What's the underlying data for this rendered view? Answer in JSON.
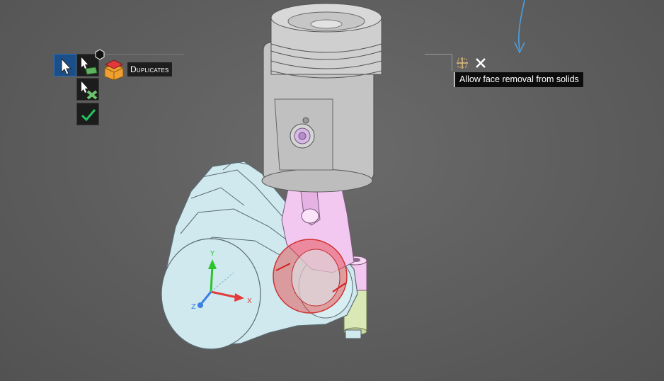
{
  "scene": {
    "triad": {
      "x_label": "X",
      "y_label": "Y",
      "z_label": "Z"
    }
  },
  "toolbar": {
    "select_tool": "select-arrow-icon",
    "duplicates_label": "Duplicates",
    "tooltip_text": "Allow face removal from solids"
  },
  "colors": {
    "background": "#5d5d5d",
    "housing": "#cfe9ef",
    "piston": "#c4c4c4",
    "rod": "#f2c8f0",
    "highlight_ring": "#e33b3b",
    "active_tool": "#1a4f8a",
    "check": "#22c55e"
  }
}
